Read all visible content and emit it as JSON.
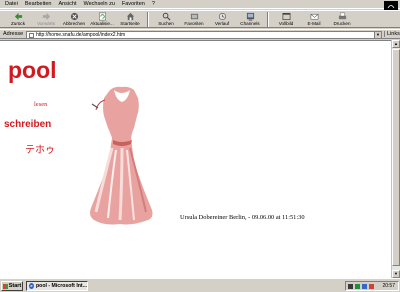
{
  "menu": [
    "Datei",
    "Bearbeiten",
    "Ansicht",
    "Wechseln zu",
    "Favoriten",
    "?"
  ],
  "toolbar": {
    "buttons": [
      {
        "label": "Zurück",
        "icon": "back-arrow-icon",
        "enabled": true
      },
      {
        "label": "Vorwärts",
        "icon": "forward-arrow-icon",
        "enabled": false
      },
      {
        "label": "Abbrechen",
        "icon": "stop-icon",
        "enabled": true
      },
      {
        "label": "Aktualisie...",
        "icon": "refresh-icon",
        "enabled": true
      },
      {
        "label": "Startseite",
        "icon": "home-icon",
        "enabled": true
      },
      {
        "label": "Suchen",
        "icon": "search-icon",
        "enabled": true
      },
      {
        "label": "Favoriten",
        "icon": "favorites-icon",
        "enabled": true
      },
      {
        "label": "Verlauf",
        "icon": "history-icon",
        "enabled": true
      },
      {
        "label": "Channels",
        "icon": "channels-icon",
        "enabled": true
      },
      {
        "label": "Vollbild",
        "icon": "fullscreen-icon",
        "enabled": true
      },
      {
        "label": "E-Mail",
        "icon": "mail-icon",
        "enabled": true
      },
      {
        "label": "Drucken",
        "icon": "print-icon",
        "enabled": true
      }
    ]
  },
  "address": {
    "label": "Adresse",
    "url": "http://home.snafu.de/ampool/index2.htm",
    "links_label": "Links"
  },
  "page": {
    "title": "pool",
    "nav_lesen": "lesen",
    "nav_schreiben": "schreiben",
    "japanese": "テホゥ",
    "footer": "Ursula Dobereiner Berlin, - 09.06.00 at 11:51:30"
  },
  "taskbar": {
    "start_label": "Start",
    "task_label": "pool - Microsoft Int...",
    "clock": "20:57"
  },
  "colors": {
    "accent": "#d2191f"
  }
}
